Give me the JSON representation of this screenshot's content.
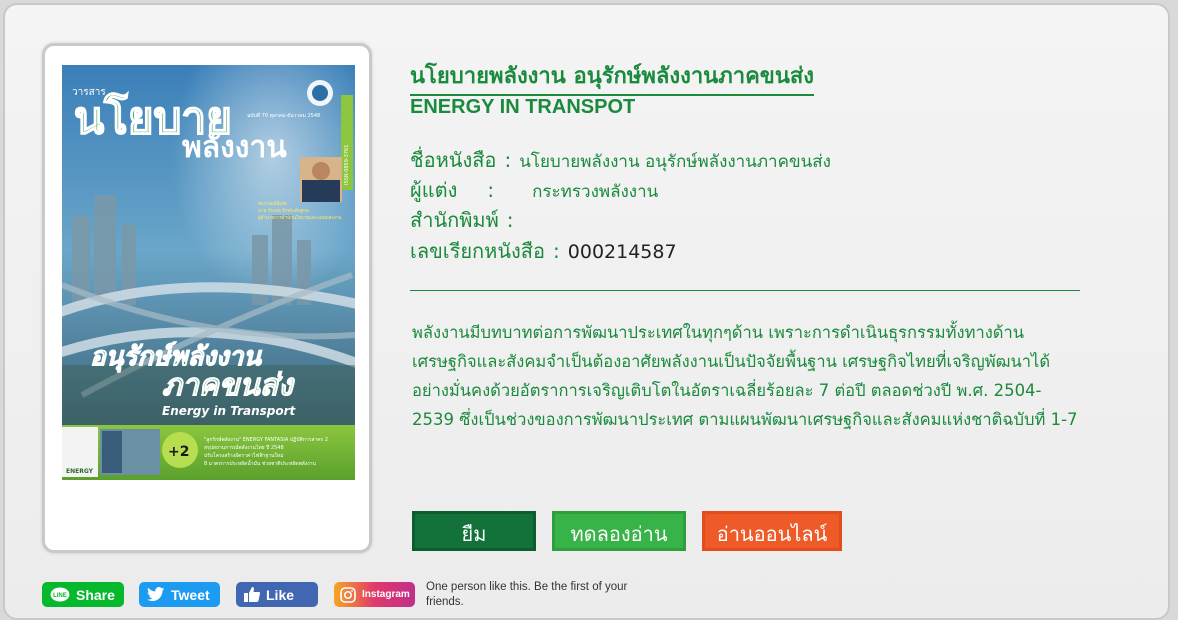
{
  "book": {
    "title_th": "นโยบายพลังงาน อนุรักษ์พลังงานภาคขนส่ง",
    "title_en": "ENERGY IN TRANSPOT",
    "fields": {
      "name_label": "ชื่อหนังสือ",
      "name_value": "นโยบายพลังงาน อนุรักษ์พลังงานภาคขนส่ง",
      "author_label": "ผู้แต่ง",
      "author_value": "กระทรวงพลังงาน",
      "publisher_label": "สำนักพิมพ์",
      "publisher_value": "",
      "callno_label": "เลขเรียกหนังสือ",
      "callno_value": "000214587",
      "separator": ":"
    },
    "description": "พลังงานมีบทบาทต่อการพัฒนาประเทศในทุกๆด้าน เพราะการดำเนินธุรกรรมทั้งทางด้านเศรษฐกิจและสังคมจำเป็นต้องอาศัยพลังงานเป็นปัจจัยพื้นฐาน เศรษฐกิจไทยที่เจริญพัฒนาได้อย่างมั่นคงด้วยอัตราการเจริญเติบโตในอัตราเฉลี่ยร้อยละ 7 ต่อปี ตลอดช่วงปี พ.ศ. 2504-2539 ซึ่งเป็นช่วงของการพัฒนาประเทศ ตามแผนพัฒนาเศรษฐกิจและสังคมแห่งชาติฉบับที่ 1-7"
  },
  "cover": {
    "magazine_small": "วารสาร",
    "title_line1": "นโยบาย",
    "title_line2": "พลังงาน",
    "subtitle_line1": "อนุรักษ์พลังงาน",
    "subtitle_line2": "ภาคขนส่ง",
    "subtitle_en": "Energy in Transport",
    "issue": "ฉบับที่ 70 ตุลาคม-ธันวาคม 2548",
    "issn": "ISSN 0859-3761",
    "bottom_line1": "\"ลูกรักษ์พลังงาน\" ENERGY FANTASIA ปฏิบัติการสาคร 2",
    "bottom_line2": "สรุปสถานการณ์พลังงานไทย ปี 2548",
    "bottom_line3": "ปรับโครงสร้างอัตราค่าไฟฟ้าฐานใหม่",
    "bottom_line4": "8 มาตรการประหยัดน้ำมัน ช่วยชาติประหยัดพลังงาน",
    "energy_logo": "ENERGY",
    "plus2": "+2",
    "person_caption": "สัมภาษณ์พิเศษ",
    "person_name": "นาย วีระพล จิรประดิษฐกุล",
    "person_title": "ผู้อำนวยการสำนักนโยบายและแผนพลังงาน"
  },
  "actions": {
    "borrow": "ยืม",
    "trial": "ทดลองอ่าน",
    "online": "อ่านออนไลน์"
  },
  "social": {
    "line": "Share",
    "tweet": "Tweet",
    "like": "Like",
    "instagram": "Instagram",
    "like_text": "One person like this. Be the first of your friends."
  },
  "colors": {
    "brand_green": "#1a8a3c",
    "borrow": "#12723a",
    "trial": "#37b347",
    "online": "#ee5a28"
  }
}
